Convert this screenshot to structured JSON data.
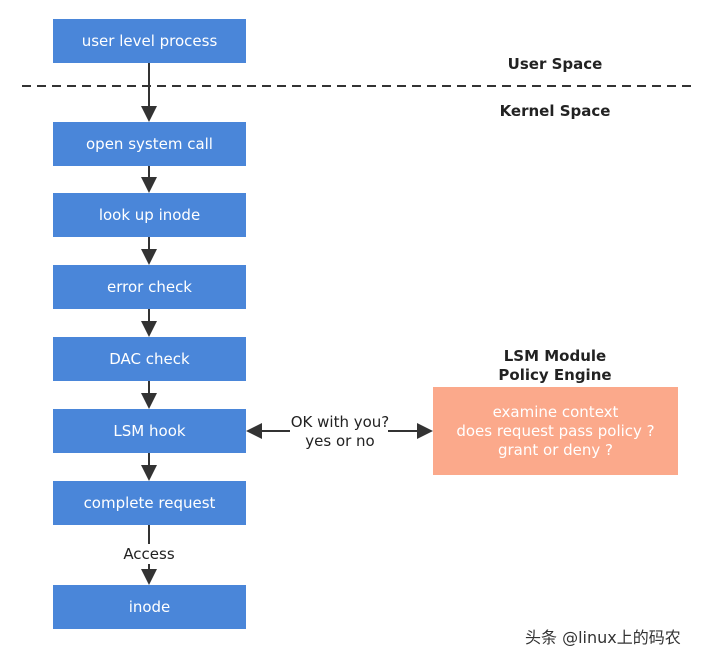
{
  "regions": {
    "user_space": "User Space",
    "kernel_space": "Kernel Space"
  },
  "flow": [
    "user level process",
    "open system call",
    "look up inode",
    "error check",
    "DAC check",
    "LSM hook",
    "complete request",
    "inode"
  ],
  "edge_labels": {
    "access": "Access",
    "query_line1": "OK with you?",
    "query_line2": "yes or no"
  },
  "lsm": {
    "title_line1": "LSM Module",
    "title_line2": "Policy Engine",
    "lines": [
      "examine context",
      "does request pass policy ?",
      "grant or deny ?"
    ]
  },
  "watermark": "头条 @linux上的码农",
  "colors": {
    "box": "#4a86d9",
    "policy_box": "#fba98b",
    "arrow": "#333333"
  }
}
